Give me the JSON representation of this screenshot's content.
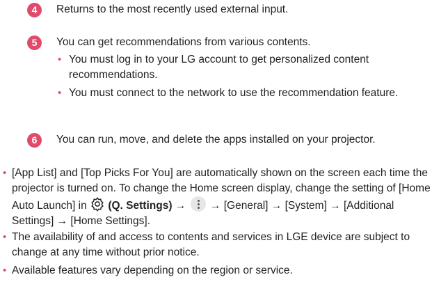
{
  "steps": [
    {
      "num": "4",
      "text": "Returns to the most recently used external input."
    },
    {
      "num": "5",
      "text": "You can get recommendations from various contents.",
      "subs": [
        "You must log in to your LG account to get personalized content recommendations.",
        "You must connect to the network to use the recommendation feature."
      ]
    },
    {
      "num": "6",
      "text": "You can run, move, and delete the apps installed on your projector."
    }
  ],
  "notes": {
    "n1_a": "[App List] and [Top Picks For You] are automatically shown on the screen each time the projector is turned on. To change the Home screen display, change the setting of [Home Auto Launch] in ",
    "n1_b": "(Q. Settings)",
    "n1_c": " → ",
    "n1_d": " → [General] → [System] → [Additional Settings] → [Home Settings].",
    "n2": "The availability of and access to contents and services in LGE device are subject to change at any time without prior notice.",
    "n3": "Available features vary depending on the region or service."
  },
  "bullet": "•",
  "colors": {
    "accent": "#e04b6c",
    "text": "#222222"
  },
  "icons": [
    "settings-gear-icon",
    "more-options-icon"
  ]
}
